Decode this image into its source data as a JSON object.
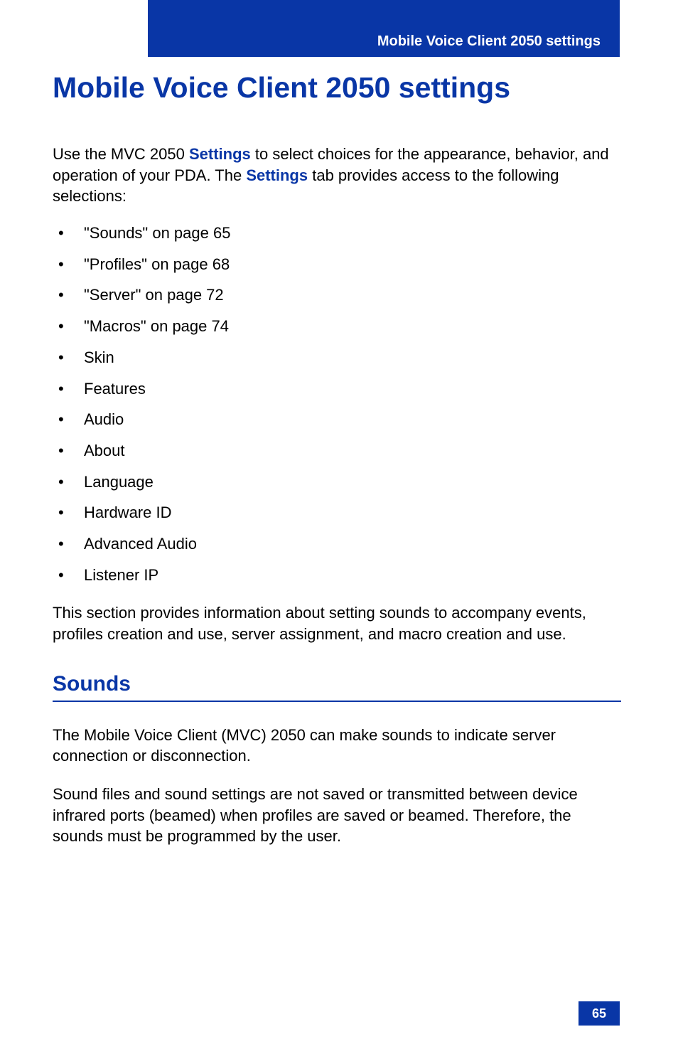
{
  "header": {
    "title": "Mobile Voice Client 2050 settings"
  },
  "main": {
    "title": "Mobile Voice Client 2050 settings",
    "intro": {
      "part1": "Use the MVC 2050 ",
      "keyword1": "Settings",
      "part2": " to select choices for the appearance, behavior, and operation of your PDA. The ",
      "keyword2": "Settings",
      "part3": " tab provides access to the following selections:"
    },
    "bullets": [
      "\"Sounds\" on page 65",
      "\"Profiles\" on page 68",
      "\"Server\" on page 72",
      "\"Macros\" on page 74",
      "Skin",
      "Features",
      "Audio",
      "About",
      "Language",
      "Hardware ID",
      "Advanced Audio",
      "Listener IP"
    ],
    "closing": "This section provides information about setting sounds to accompany events, profiles creation and use, server assignment, and macro creation and use."
  },
  "section": {
    "heading": "Sounds",
    "para1": "The Mobile Voice Client (MVC) 2050 can make sounds to indicate server connection or disconnection.",
    "para2": "Sound files and sound settings are not saved or transmitted between device infrared ports (beamed) when profiles are saved or beamed. Therefore, the sounds must be programmed by the user."
  },
  "page_number": "65"
}
